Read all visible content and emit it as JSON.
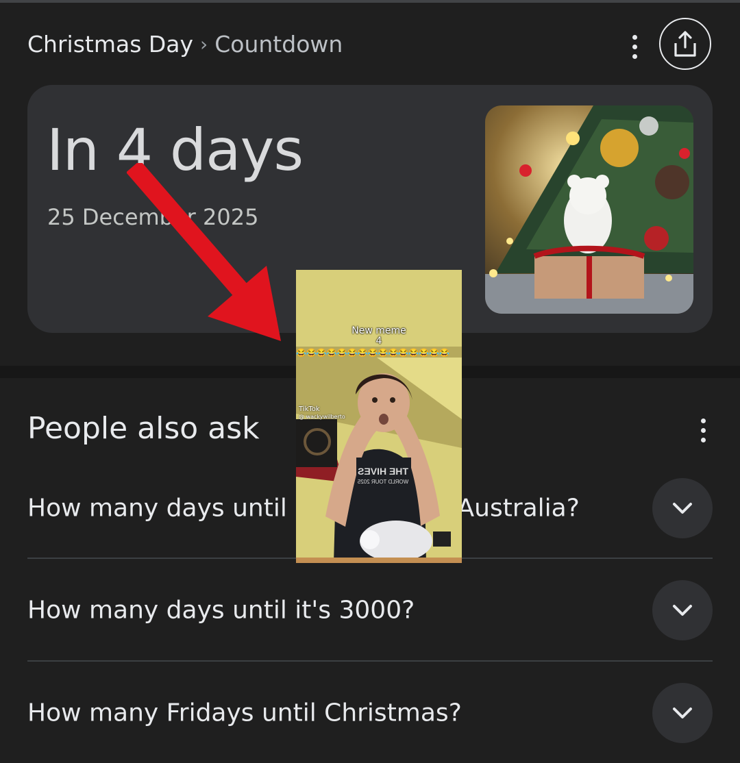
{
  "header": {
    "breadcrumb_parent": "Christmas Day",
    "breadcrumb_separator": "›",
    "breadcrumb_current": "Countdown"
  },
  "countdown_card": {
    "relative_time": "In 4 days",
    "date": "25 December 2025"
  },
  "people_also_ask": {
    "title": "People also ask",
    "questions": [
      "How many days until Christmas in Australia?",
      "How many days until it's 3000?",
      "How many Fridays until Christmas?"
    ]
  },
  "overlay_video": {
    "caption_line1": "New meme",
    "caption_line2": "4",
    "emoji": "😂😂😂😂😂😂😂😂😂😂😂😂😂😂😂",
    "watermark_brand": "TikTok",
    "watermark_handle": "@ wackywilberto",
    "shirt_text": "THE HIVES",
    "shirt_subtext": "WORLD TOUR 2025"
  },
  "icons": {
    "share": "share-icon",
    "more": "more-vert-icon",
    "expand": "chevron-down-icon",
    "arrow": "red-arrow-annotation"
  },
  "colors": {
    "background": "#1f1f1f",
    "card": "#303134",
    "text": "#e8eaed",
    "annotation_arrow": "#e0141e"
  }
}
